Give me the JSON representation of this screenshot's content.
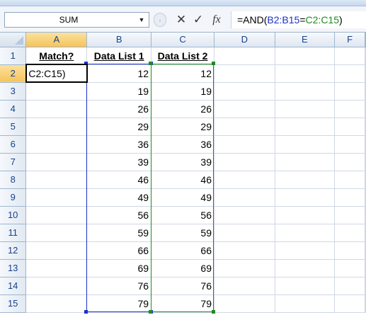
{
  "formula_bar": {
    "name_box": "SUM",
    "name_box_arrow": "▼",
    "cancel_glyph": "✕",
    "enter_glyph": "✓",
    "fx_glyph": "fx",
    "formula_parts": [
      {
        "text": "=AND(",
        "color": "default"
      },
      {
        "text": "B2:B15",
        "color": "blue"
      },
      {
        "text": "=",
        "color": "default"
      },
      {
        "text": "C2:C15",
        "color": "green"
      },
      {
        "text": ")",
        "color": "default"
      }
    ]
  },
  "sheet": {
    "columns": [
      "A",
      "B",
      "C",
      "D",
      "E",
      "F"
    ],
    "rows": [
      "1",
      "2",
      "3",
      "4",
      "5",
      "6",
      "7",
      "8",
      "9",
      "10",
      "11",
      "12",
      "13",
      "14",
      "15"
    ],
    "active_cell": "A2",
    "cells": {
      "A1": "Match?",
      "B1": "Data List 1",
      "C1": "Data List 2",
      "A2": "C2:C15)",
      "B2": "12",
      "C2": "12",
      "B3": "19",
      "C3": "19",
      "B4": "26",
      "C4": "26",
      "B5": "29",
      "C5": "29",
      "B6": "36",
      "C6": "36",
      "B7": "39",
      "C7": "39",
      "B8": "46",
      "C8": "46",
      "B9": "49",
      "C9": "49",
      "B10": "56",
      "C10": "56",
      "B11": "59",
      "C11": "59",
      "B12": "66",
      "C12": "66",
      "B13": "69",
      "C13": "69",
      "B14": "76",
      "C14": "76",
      "B15": "79",
      "C15": "79"
    },
    "colors": {
      "range_blue": "#1a32c8",
      "range_green": "#1f8b1f",
      "header_text": "#15428b",
      "active_header": "#f6c35a"
    }
  }
}
